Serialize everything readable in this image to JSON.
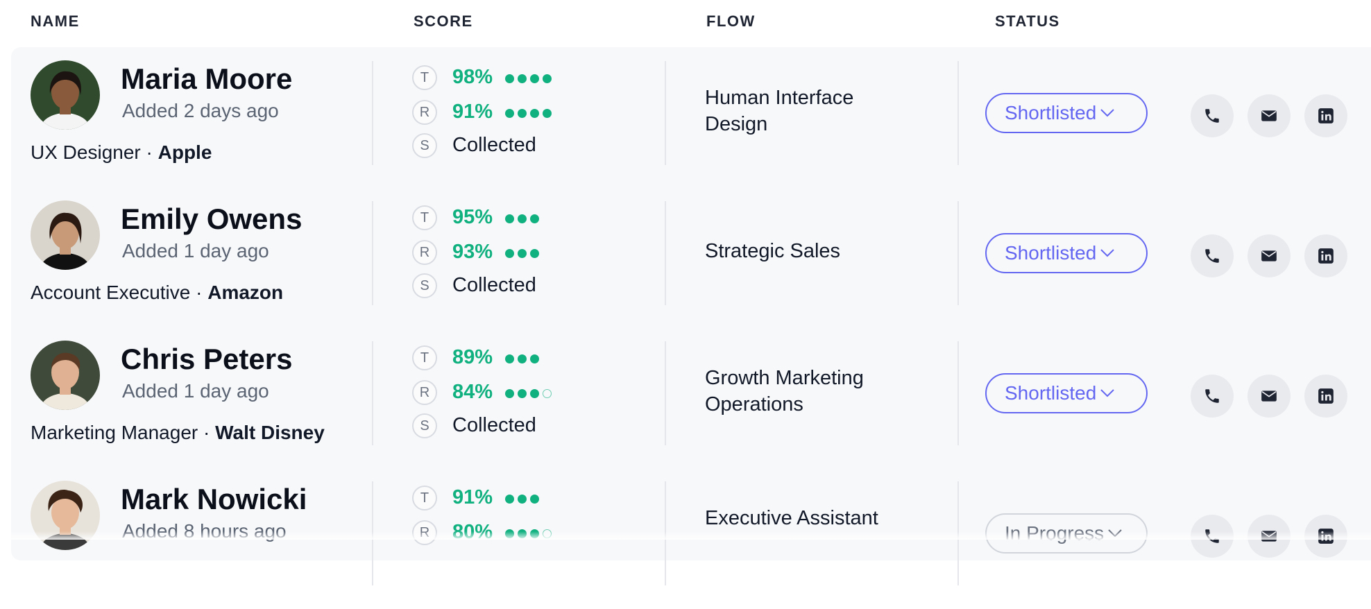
{
  "header": {
    "name": "NAME",
    "score": "SCORE",
    "flow": "FLOW",
    "status": "STATUS"
  },
  "colors": {
    "accent": "#6366f1",
    "score_green": "#10b07f",
    "icon_dark": "#1f2433"
  },
  "icons": {
    "phone": "phone-icon",
    "email": "mail-icon",
    "linkedin": "linkedin-icon",
    "dropdown": "chevron-down-icon"
  },
  "candidates": [
    {
      "name": "Maria Moore",
      "added": "Added 2 days ago",
      "role": "UX Designer",
      "sep": " · ",
      "company": "Apple",
      "scores": [
        {
          "letter": "T",
          "value": "98%",
          "dots_filled": 4,
          "dots_total": 4
        },
        {
          "letter": "R",
          "value": "91%",
          "dots_filled": 4,
          "dots_total": 4
        },
        {
          "letter": "S",
          "value": "Collected"
        }
      ],
      "flow": "Human Interface Design",
      "status": "Shortlisted"
    },
    {
      "name": "Emily Owens",
      "added": "Added 1 day ago",
      "role": "Account Executive",
      "sep": " · ",
      "company": "Amazon",
      "scores": [
        {
          "letter": "T",
          "value": "95%",
          "dots_filled": 3,
          "dots_total": 3
        },
        {
          "letter": "R",
          "value": "93%",
          "dots_filled": 3,
          "dots_total": 3
        },
        {
          "letter": "S",
          "value": "Collected"
        }
      ],
      "flow": "Strategic Sales",
      "status": "Shortlisted"
    },
    {
      "name": "Chris Peters",
      "added": "Added 1 day ago",
      "role": "Marketing Manager",
      "sep": " · ",
      "company": "Walt Disney",
      "scores": [
        {
          "letter": "T",
          "value": "89%",
          "dots_filled": 3,
          "dots_total": 3
        },
        {
          "letter": "R",
          "value": "84%",
          "dots_filled": 3,
          "dots_total": 4
        },
        {
          "letter": "S",
          "value": "Collected"
        }
      ],
      "flow": "Growth Marketing Operations",
      "status": "Shortlisted"
    },
    {
      "name": "Mark Nowicki",
      "added": "Added 8 hours ago",
      "role": "",
      "sep": "",
      "company": "",
      "scores": [
        {
          "letter": "T",
          "value": "91%",
          "dots_filled": 3,
          "dots_total": 3
        },
        {
          "letter": "R",
          "value": "80%",
          "dots_filled": 3,
          "dots_total": 4
        }
      ],
      "flow": "Executive Assistant",
      "status": "In Progress"
    }
  ]
}
